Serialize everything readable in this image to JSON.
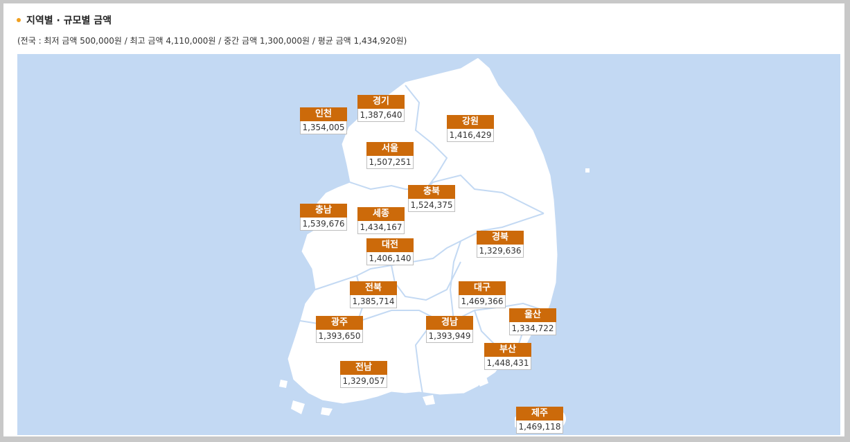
{
  "header": {
    "title": "지역별 · 규모별 금액",
    "summary": "(전국 : 최저 금액 500,000원 / 최고 금액 4,110,000원 / 중간 금액 1,300,000원 / 평균 금액 1,434,920원)"
  },
  "regions": [
    {
      "name": "인천",
      "value": "1,354,005"
    },
    {
      "name": "경기",
      "value": "1,387,640"
    },
    {
      "name": "강원",
      "value": "1,416,429"
    },
    {
      "name": "서울",
      "value": "1,507,251"
    },
    {
      "name": "충북",
      "value": "1,524,375"
    },
    {
      "name": "충남",
      "value": "1,539,676"
    },
    {
      "name": "세종",
      "value": "1,434,167"
    },
    {
      "name": "경북",
      "value": "1,329,636"
    },
    {
      "name": "대전",
      "value": "1,406,140"
    },
    {
      "name": "전북",
      "value": "1,385,714"
    },
    {
      "name": "대구",
      "value": "1,469,366"
    },
    {
      "name": "울산",
      "value": "1,334,722"
    },
    {
      "name": "광주",
      "value": "1,393,650"
    },
    {
      "name": "경남",
      "value": "1,393,949"
    },
    {
      "name": "부산",
      "value": "1,448,431"
    },
    {
      "name": "전남",
      "value": "1,329,057"
    },
    {
      "name": "제주",
      "value": "1,469,118"
    }
  ],
  "colors": {
    "label_bg": "#cc6a0a",
    "sea": "#c3d9f3",
    "land": "#ffffff",
    "bullet": "#f0a020"
  }
}
